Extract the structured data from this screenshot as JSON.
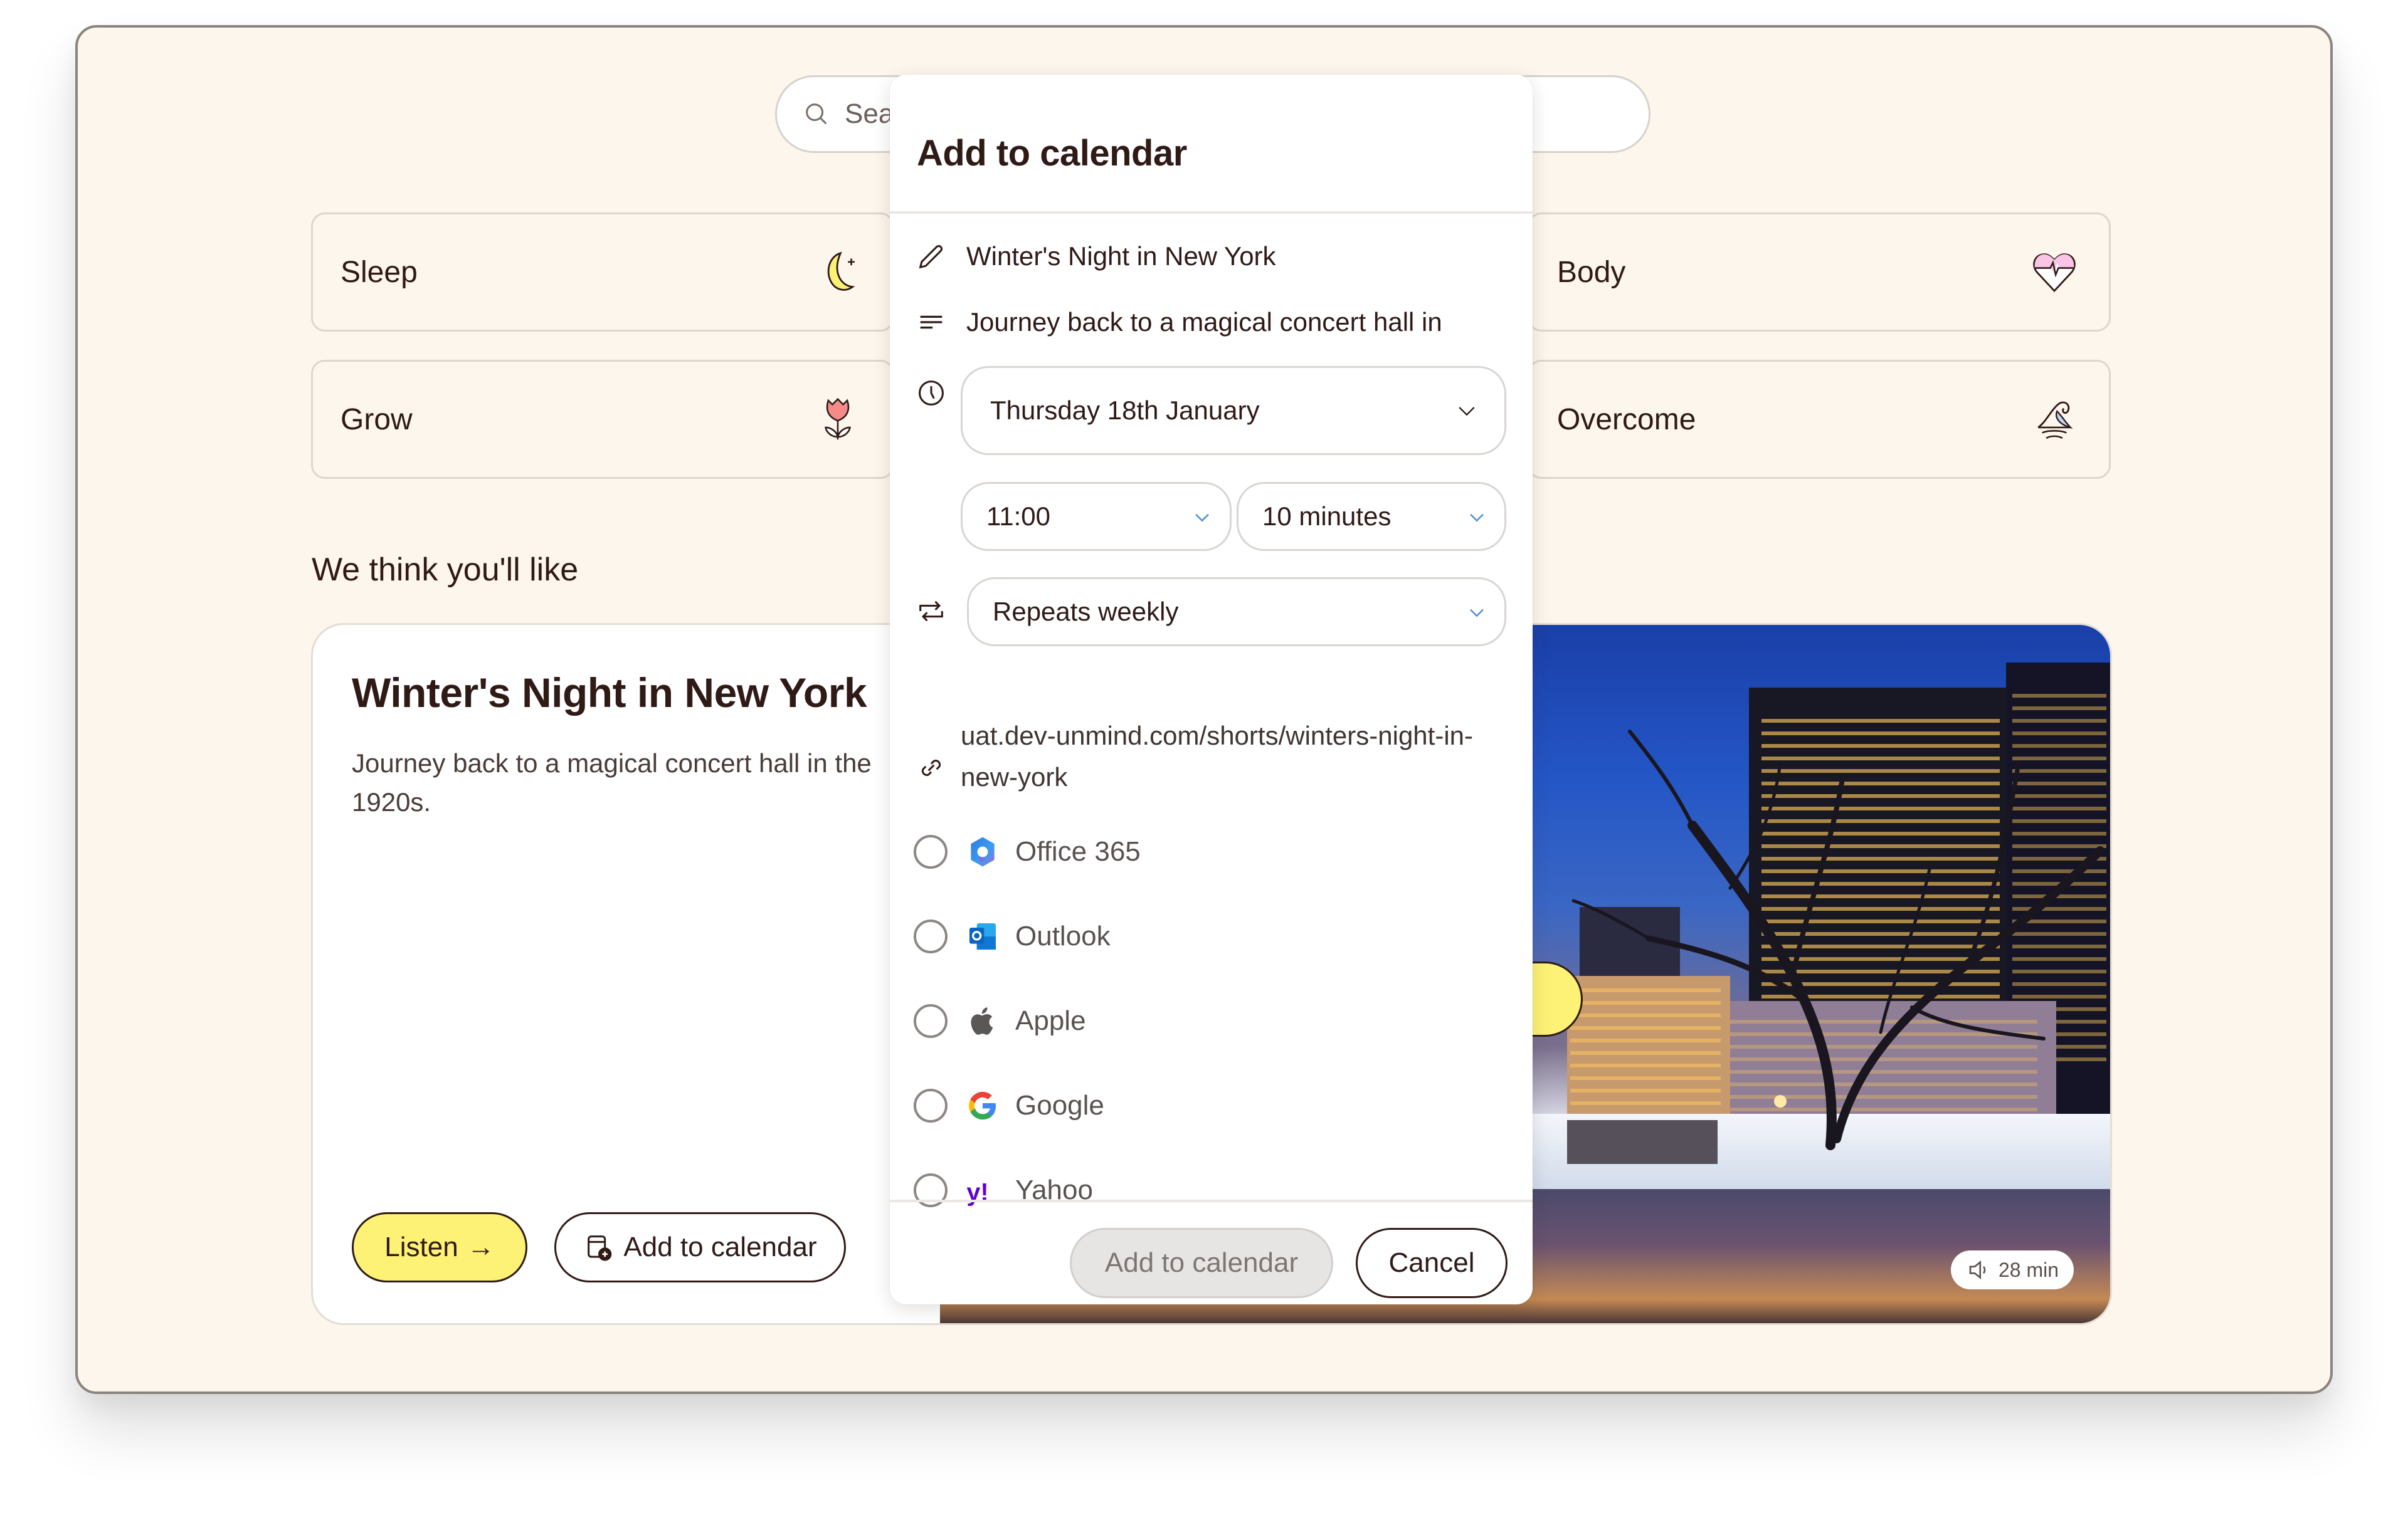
{
  "search": {
    "placeholder": "Search"
  },
  "categories": [
    {
      "label": "Sleep",
      "icon": "moon-icon"
    },
    {
      "label": "Grow",
      "icon": "tulip-icon"
    },
    {
      "label": "Body",
      "icon": "heart-pulse-icon"
    },
    {
      "label": "Overcome",
      "icon": "wave-icon"
    }
  ],
  "section": {
    "title": "We think you'll like"
  },
  "feature": {
    "title": "Winter's Night in New York",
    "description": "Journey back to a magical concert hall in the 1920s.",
    "listen_label": "Listen",
    "listen_arrow": "→",
    "add_calendar_label": "Add to calendar",
    "duration": "28 min"
  },
  "modal": {
    "title": "Add to calendar",
    "event_title": "Winter's Night in New York",
    "event_description": "Journey back to a magical concert hall in",
    "date": "Thursday 18th January",
    "time": "11:00",
    "duration": "10 minutes",
    "repeat": "Repeats weekly",
    "link": "uat.dev-unmind.com/shorts/winters-night-in-new-york",
    "providers": [
      {
        "name": "Office 365",
        "selected": false
      },
      {
        "name": "Outlook",
        "selected": false
      },
      {
        "name": "Apple",
        "selected": false
      },
      {
        "name": "Google",
        "selected": false
      },
      {
        "name": "Yahoo",
        "selected": false
      }
    ],
    "add_button": "Add to calendar",
    "add_button_disabled": true,
    "cancel_button": "Cancel"
  },
  "colors": {
    "page_bg": "#fdf6ec",
    "accent_yellow": "#fdf276",
    "text_dark": "#2f1a16",
    "chevron_blue": "#4a90d9"
  }
}
